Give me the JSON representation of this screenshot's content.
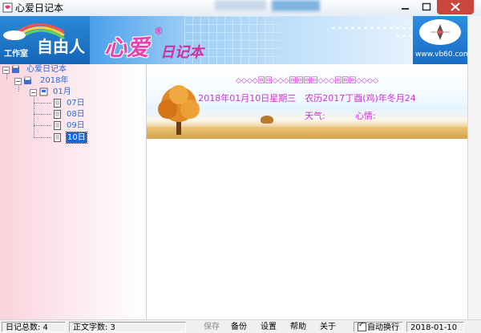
{
  "window": {
    "title": "心爱日记本",
    "controls": {
      "minimize": "─",
      "maximize": "▢",
      "close": "✕"
    }
  },
  "banner": {
    "left_text": "自由人",
    "left_sub": "工作室",
    "logo_main": "心爱",
    "logo_reg": "®",
    "logo_sub": "日记本",
    "url": "www.vb60.com"
  },
  "tree": {
    "root": "心爱日记本",
    "year": "2018年",
    "month": "01月",
    "days": [
      "07日",
      "08日",
      "09日",
      "10日"
    ],
    "selected_day": "10日"
  },
  "entry_header": {
    "decoration": "◇◇◇◇回回◇◇◇回回回回◇◇◇回回回◇◇◇◇",
    "date": "2018年01月10日星期三　农历2017丁酉(鸡)年冬月24",
    "weather_label": "天气:",
    "mood_label": "心情:"
  },
  "status": {
    "diary_total": "日记总数: 4",
    "text_count": "正文字数: 3",
    "buttons": {
      "save": "保存",
      "backup": "备份",
      "settings": "设置",
      "help": "帮助",
      "about": "关于"
    },
    "auto_wrap": "自动换行",
    "auto_wrap_checked": true,
    "date": "2018-01-10"
  },
  "colors": {
    "accent_pink": "#d12ed2",
    "tree_text": "#2a6ad8",
    "selection": "#1768d6",
    "close_red": "#c9463d"
  }
}
